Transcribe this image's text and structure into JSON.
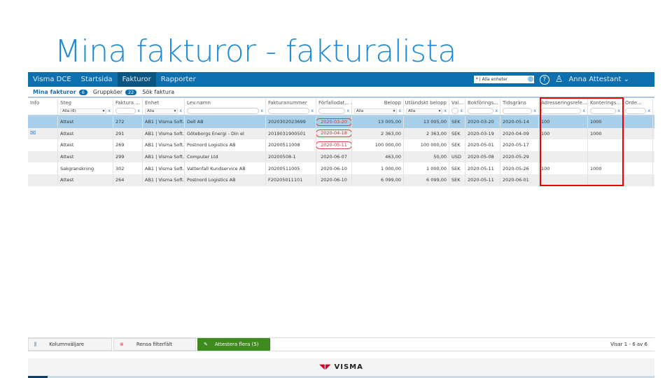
{
  "slide_title": "Mina fakturor - fakturalista",
  "nav": {
    "items": [
      "Visma DCE",
      "Startsida",
      "Fakturor",
      "Rapporter"
    ],
    "unit_selector": "* | Alla enheter",
    "user": "Anna Attestant ⌄"
  },
  "subtabs": [
    {
      "label": "Mina fakturor",
      "count": "6"
    },
    {
      "label": "Gruppköer",
      "count": "22"
    },
    {
      "label": "Sök faktura"
    }
  ],
  "columns": [
    "Info",
    "Steg",
    "Faktura ...",
    "Enhet",
    "Lev.namn",
    "Fakturanummer",
    "Förfallodat... ▴",
    "Belopp",
    "Utländskt belopp",
    "Val...",
    "Bokförings...",
    "Tidsgräns",
    "Adresseringsrefe...",
    "Konterings...",
    "Orde..."
  ],
  "filters": {
    "steg": "Alla (6)",
    "enhet": "Alla",
    "belopp": "Alla",
    "utlandskt": "Alla",
    "clear": "x"
  },
  "rows": [
    {
      "info": "",
      "steg": "Attest",
      "nr": "272",
      "enhet": "AB1 | Visma Soft...",
      "lev": "Dell AB",
      "fnr": "2020302023699",
      "due": "2020-03-20",
      "overdue": true,
      "belopp": "13 005,00",
      "utl": "13 005,00",
      "val": "SEK",
      "bok": "2020-03-20",
      "tid": "2020-05-14",
      "adr": "100",
      "kont": "1000",
      "orde": ""
    },
    {
      "info": "mail",
      "steg": "Attest",
      "nr": "291",
      "enhet": "AB1 | Visma Soft...",
      "lev": "Göteborgs Energi - Din el",
      "fnr": "2019031900501",
      "due": "2020-04-18",
      "overdue": true,
      "belopp": "2 363,00",
      "utl": "2 363,00",
      "val": "SEK",
      "bok": "2020-03-19",
      "tid": "2020-04-09",
      "adr": "100",
      "kont": "1000",
      "orde": ""
    },
    {
      "info": "",
      "steg": "Attest",
      "nr": "269",
      "enhet": "AB1 | Visma Soft...",
      "lev": "Postnord Logistics AB",
      "fnr": "20200511008",
      "due": "2020-05-11",
      "overdue": true,
      "belopp": "100 000,00",
      "utl": "100 000,00",
      "val": "SEK",
      "bok": "2020-05-01",
      "tid": "2020-05-17",
      "adr": "",
      "kont": "",
      "orde": ""
    },
    {
      "info": "",
      "steg": "Attest",
      "nr": "299",
      "enhet": "AB1 | Visma Soft...",
      "lev": "Computer Ltd",
      "fnr": "20200508-1",
      "due": "2020-06-07",
      "overdue": false,
      "belopp": "463,00",
      "utl": "50,00",
      "val": "USD",
      "bok": "2020-05-08",
      "tid": "2020-05-29",
      "adr": "",
      "kont": "",
      "orde": ""
    },
    {
      "info": "",
      "steg": "Sakgranskning",
      "nr": "302",
      "enhet": "AB1 | Visma Soft...",
      "lev": "Vattenfall Kundservice AB",
      "fnr": "20200511005",
      "due": "2020-06-10",
      "overdue": false,
      "belopp": "1 000,00",
      "utl": "1 000,00",
      "val": "SEK",
      "bok": "2020-05-11",
      "tid": "2020-05-26",
      "adr": "100",
      "kont": "1000",
      "orde": ""
    },
    {
      "info": "",
      "steg": "Attest",
      "nr": "264",
      "enhet": "AB1 | Visma Soft...",
      "lev": "Postnord Logistics AB",
      "fnr": "F20205011101",
      "due": "2020-06-10",
      "overdue": false,
      "belopp": "6 099,00",
      "utl": "6 099,00",
      "val": "SEK",
      "bok": "2020-05-11",
      "tid": "2020-06-01",
      "adr": "",
      "kont": "",
      "orde": ""
    }
  ],
  "toolbar": {
    "column_picker": "Kolumnväljare",
    "clear_filters": "Rensa filterfält",
    "approve_many": "Attestera flera (5)",
    "pager": "Visar 1 - 6 av 6"
  },
  "footer": {
    "logo": "VISMA"
  },
  "colors": {
    "nav": "#0e6fae",
    "selected_row": "#a8cfe9",
    "highlight": "#e00000",
    "approve": "#3f8a1c"
  }
}
